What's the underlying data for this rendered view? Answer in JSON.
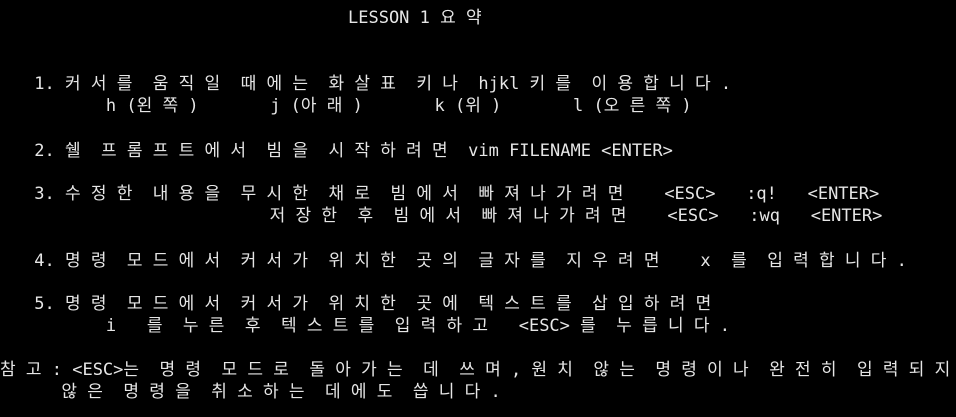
{
  "terminal": {
    "background": "#000000",
    "foreground": "#e6e6e6",
    "title": "LESSON 1 요 약",
    "lines": {
      "item1_line1": " 1. 커 서 를  움 직 일  때 에 는  화 살 표  키 나  hjkl 키 를  이 용 합 니 다 .",
      "item1_line2": "        h (왼 쪽 )       j (아 래 )       k (위 )       l (오 른 쪽 )",
      "item2": " 2. 쉘  프 롬 프 트 에 서  빔 을  시 작 하 려 면  vim FILENAME <ENTER>",
      "item3_line1": " 3. 수 정 한  내 용 을  무 시 한  채 로  빔 에 서  빠 져 나 가 려 면    <ESC>   :q!   <ENTER>",
      "item3_line2": "                        저 장 한  후  빔 에 서  빠 져 나 가 려 면    <ESC>   :wq   <ENTER>",
      "item4": " 4. 명 령  모 드 에 서  커 서 가  위 치 한  곳 의  글 자 를  지 우 려 면    x  를  입 력 합 니 다 .",
      "item5_line1": " 5. 명 령  모 드 에 서  커 서 가  위 치 한  곳 에  텍 스 트 를  삽 입 하 려 면",
      "item5_line2": "        i   를  누 른  후  텍 스 트 를  입 력 하 고   <ESC> 를  누 릅 니 다 .",
      "note_line1": "참 고 : <ESC>는  명 령  모 드 로  돌 아 가 는  데  쓰 며 , 원 치  않 는  명 령 이 나  완 전 히  입 력 되 지",
      "note_line2": "      않 은  명 령 을  취 소 하 는  데 에 도  씁 니 다 ."
    }
  }
}
